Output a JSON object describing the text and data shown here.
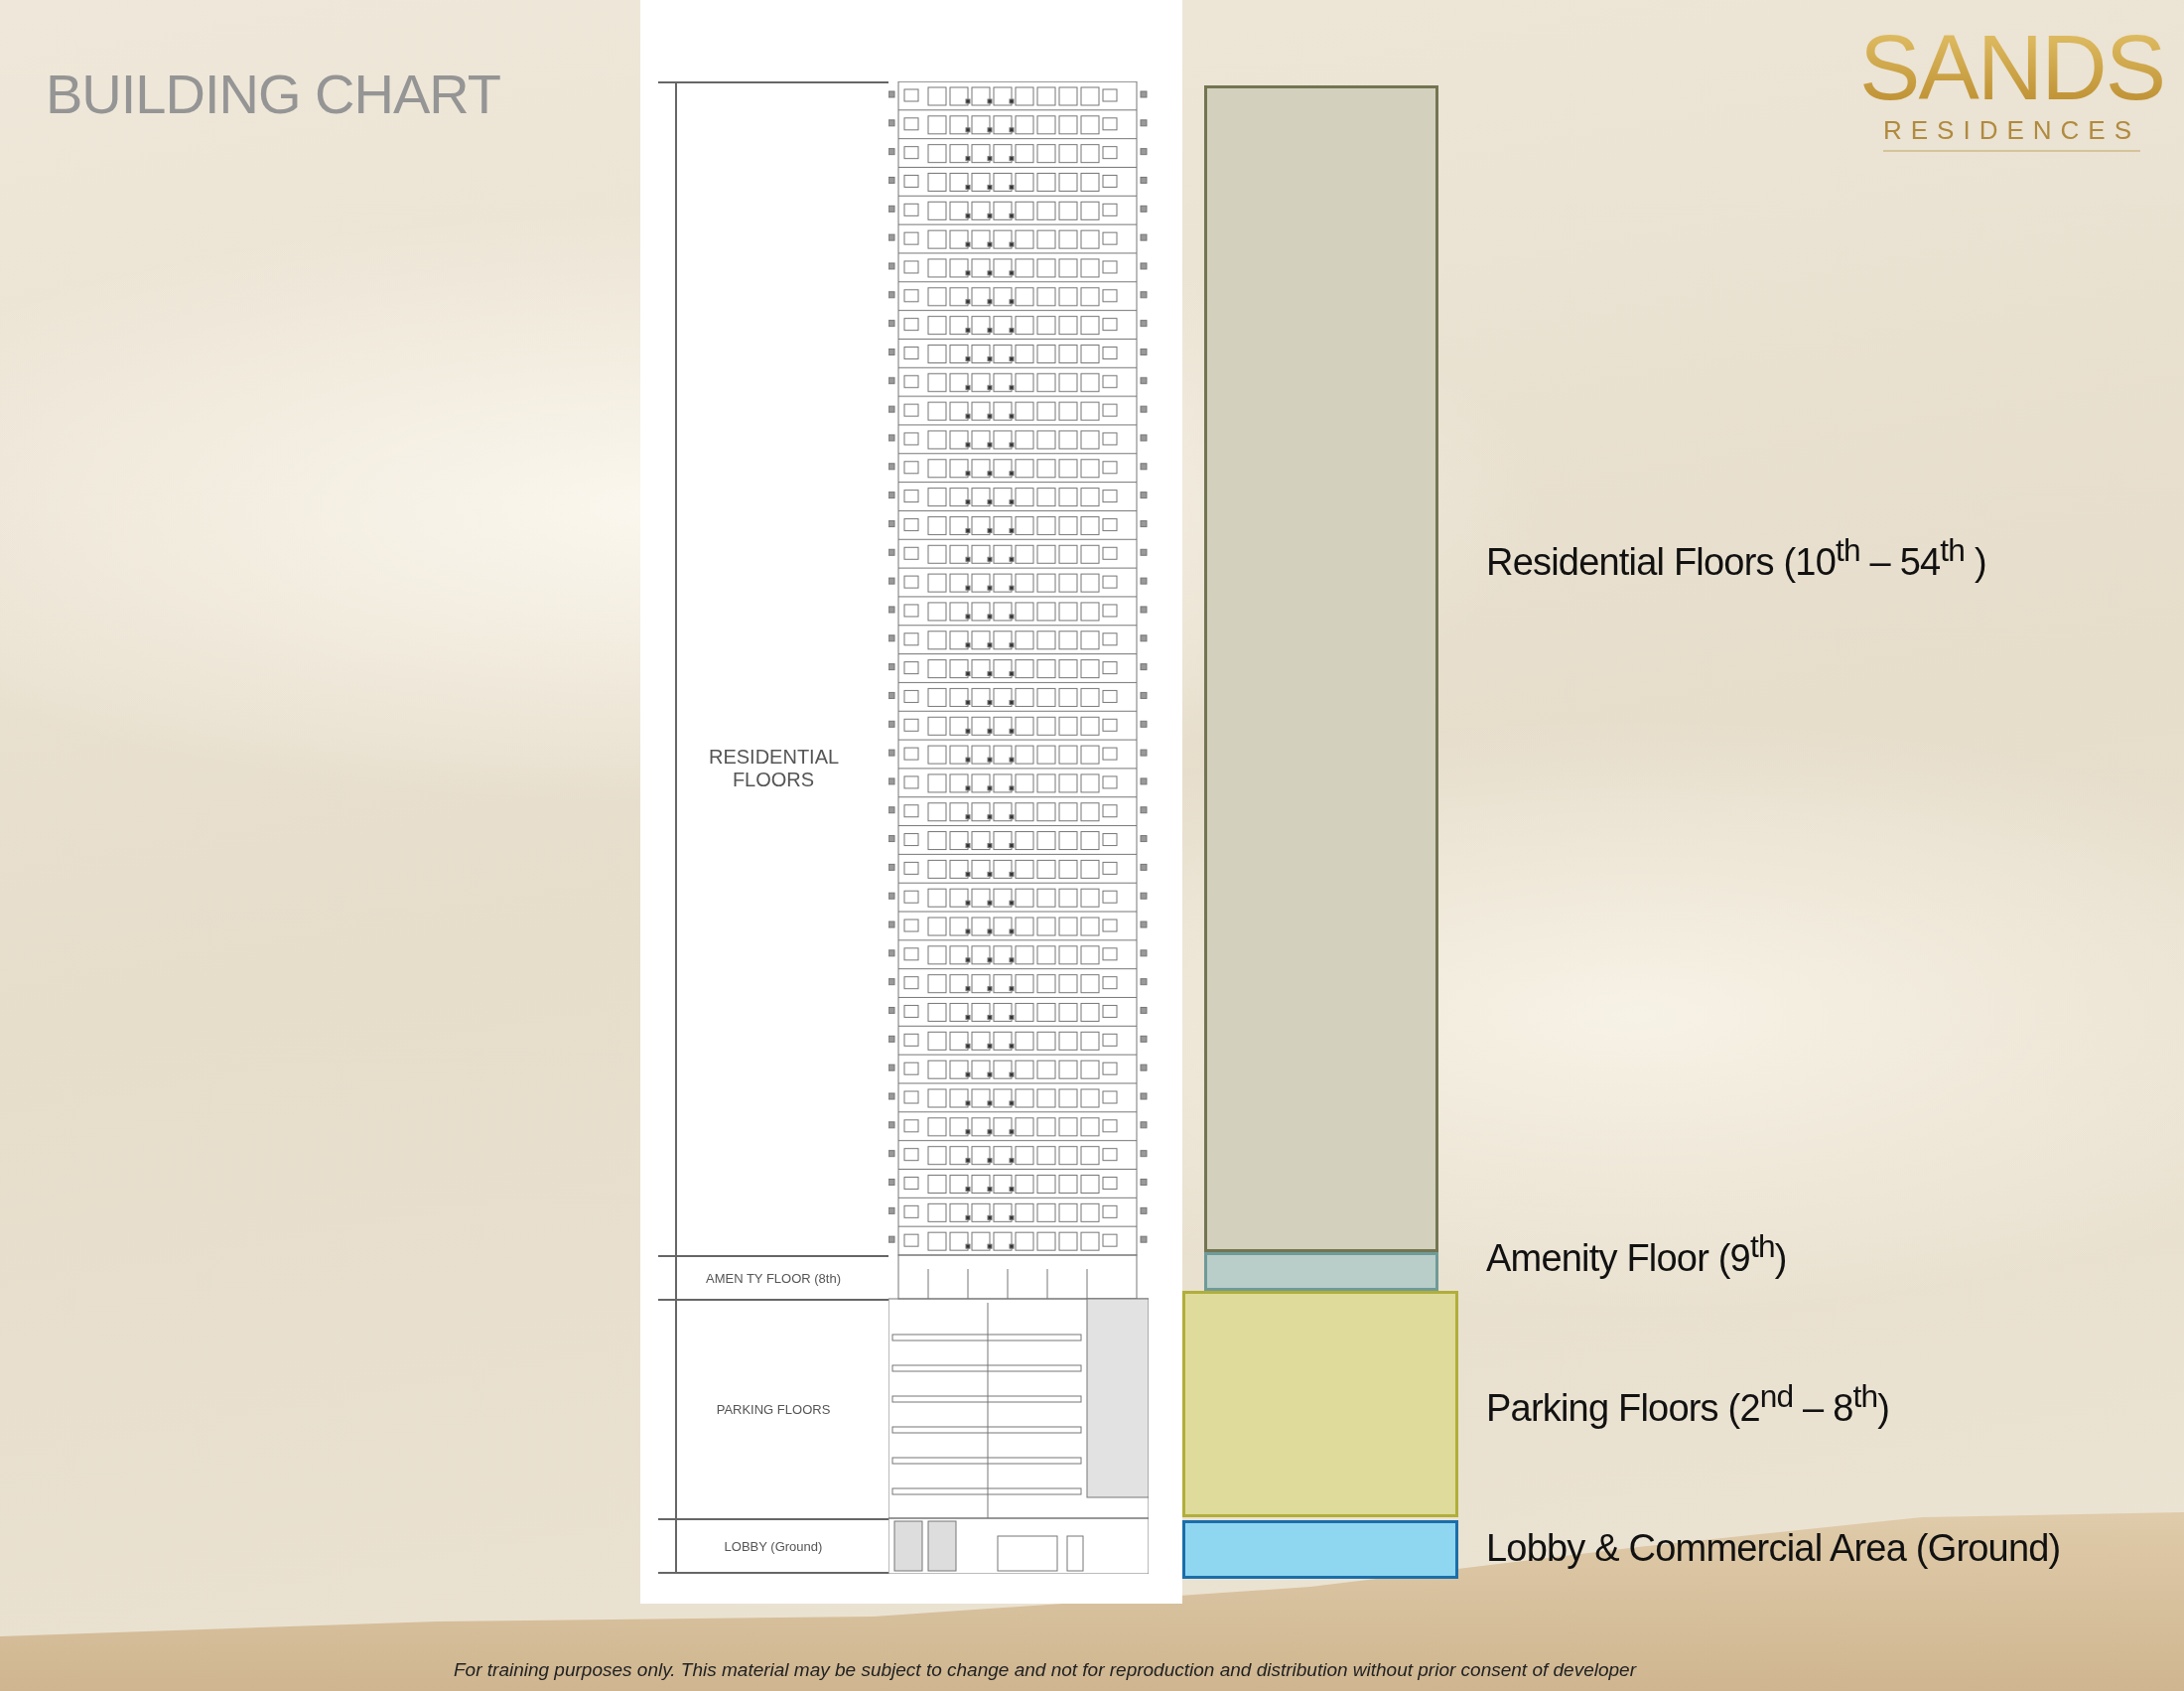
{
  "title": "BUILDING CHART",
  "logo": {
    "name": "SANDS",
    "tagline": "RESIDENCES"
  },
  "elevation": {
    "sections": [
      {
        "kind": "residential",
        "label": "RESIDENTIAL FLOORS"
      },
      {
        "kind": "amenity",
        "label": "AMEN TY FLOOR (8th)"
      },
      {
        "kind": "parking",
        "label": "PARKING FLOORS"
      },
      {
        "kind": "lobby",
        "label": "LOBBY (Ground)"
      }
    ]
  },
  "floors": [
    {
      "kind": "residential",
      "label": "Residential Floors (10$^{th}$ – 54$^{th}$ )",
      "color": "#d3d0bd"
    },
    {
      "kind": "amenity",
      "label": "Amenity Floor (9$^{th}$)",
      "color": "#b9cdc9"
    },
    {
      "kind": "parking",
      "label": "Parking Floors (2$^{nd}$ – 8$^{th}$)",
      "color": "#dedb9b"
    },
    {
      "kind": "lobby",
      "label": "Lobby & Commercial Area (Ground)",
      "color": "#8fd6f0"
    }
  ],
  "footer": "For training purposes only. This material may be subject to change and not for reproduction and distribution without prior consent of developer"
}
